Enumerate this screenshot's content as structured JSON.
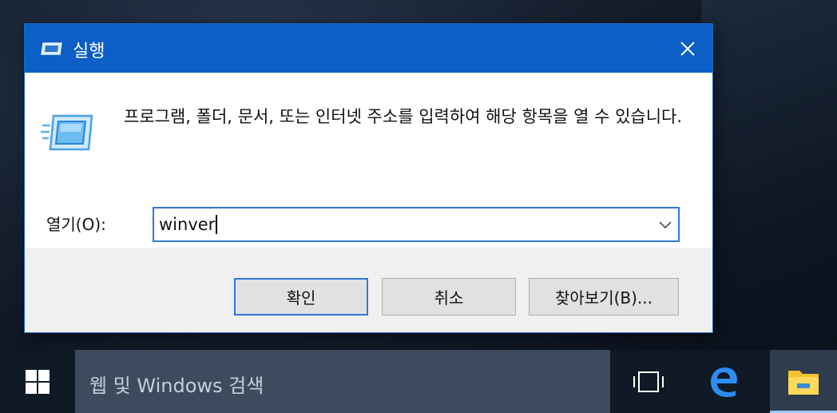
{
  "dialog": {
    "title": "실행",
    "description": "프로그램, 폴더, 문서, 또는 인터넷 주소를 입력하여 해당 항목을 열 수 있습니다.",
    "open_label": "열기(O):",
    "input_value": "winver",
    "buttons": {
      "ok": "확인",
      "cancel": "취소",
      "browse": "찾아보기(B)..."
    },
    "icons": [
      "run-icon",
      "close-icon",
      "chevron-down-icon"
    ]
  },
  "taskbar": {
    "search_placeholder": "웹 및 Windows 검색",
    "icons": [
      "windows-start-icon",
      "task-view-icon",
      "edge-icon",
      "file-explorer-icon"
    ]
  },
  "colors": {
    "titlebar": "#0b5fc6",
    "accent_border": "#2f78d6",
    "taskbar": "#0f1a26",
    "search_box": "#3c4b5e"
  }
}
